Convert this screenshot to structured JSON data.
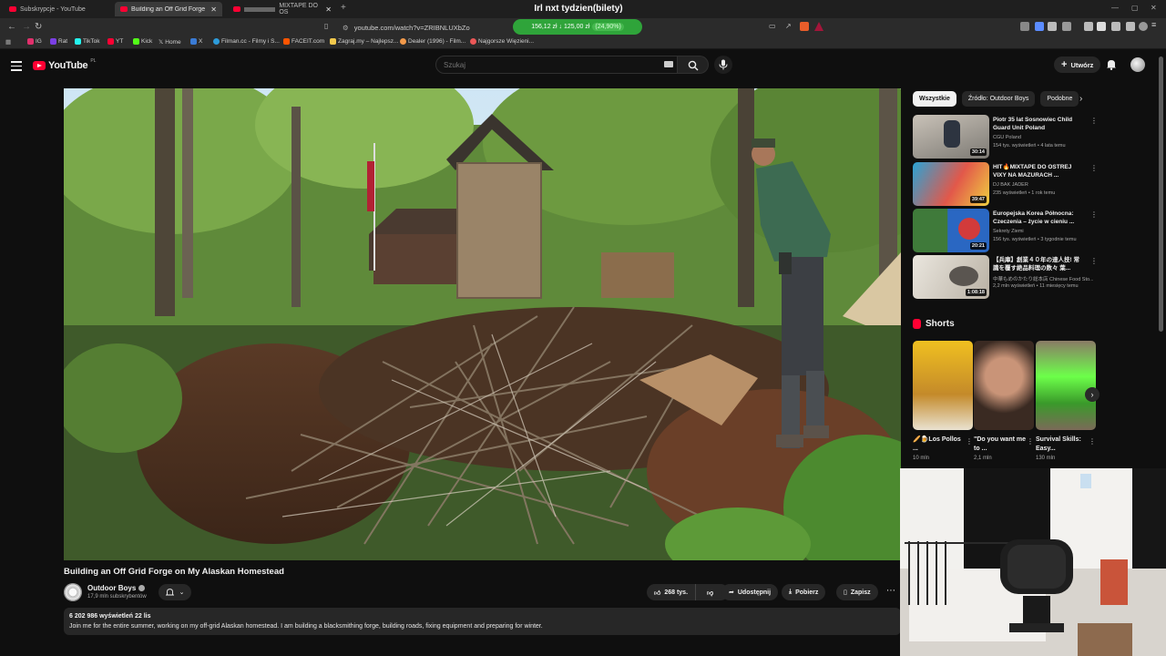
{
  "browser": {
    "tabs": [
      {
        "label": "Subskrypcje - YouTube"
      },
      {
        "label": "Building an Off Grid Forge o"
      },
      {
        "label": "MIXTAPE DO OS"
      }
    ],
    "overlay_title": "Irl nxt tydzien(bilety)",
    "url": "youtube.com/watch?v=ZRIBNLUXbZo",
    "price_widget": {
      "text": "156,12 zł ↓ 125,00 zł",
      "percent": "(24,90%)"
    },
    "bookmarks": [
      {
        "label": "IG",
        "color": "#e1306c"
      },
      {
        "label": "Rat",
        "color": "#7b3fe4"
      },
      {
        "label": "TikTok",
        "color": "#25f4ee"
      },
      {
        "label": "YT",
        "color": "#ff0033"
      },
      {
        "label": "Kick",
        "color": "#53fc18"
      },
      {
        "label": "Home",
        "color": "#ffffff"
      },
      {
        "label": "X",
        "color": "#3a7bd5"
      },
      {
        "label": "Filman.cc - Filmy i S...",
        "color": "#2d9cdb"
      },
      {
        "label": "FACEIT.com",
        "color": "#ff5500"
      },
      {
        "label": "Zagraj.my – Najlepsz...",
        "color": "#f2c94c"
      },
      {
        "label": "Dealer (1996) - Film...",
        "color": "#f2994a"
      },
      {
        "label": "Najgorsze Więzieni...",
        "color": "#eb5757"
      }
    ]
  },
  "header": {
    "logo_text": "YouTube",
    "logo_region": "PL",
    "search_placeholder": "Szukaj",
    "create_label": "Utwórz"
  },
  "video": {
    "title": "Building an Off Grid Forge on My Alaskan Homestead",
    "channel": "Outdoor Boys",
    "subscribers": "17,9 mln subskrybentów",
    "likes": "268 tys.",
    "share_label": "Udostępnij",
    "download_label": "Pobierz",
    "save_label": "Zapisz",
    "stats": "6 202 986 wyświetleń  22 lis",
    "description": "Join me for the entire summer, working on my off-grid Alaskan homestead. I am building a blacksmithing forge, building roads, fixing equipment and preparing for winter."
  },
  "sidebar": {
    "chips": [
      "Wszystkie",
      "Źródło: Outdoor Boys",
      "Podobne"
    ],
    "recommendations": [
      {
        "title": "Piotr 35 lat Sosnowiec Child Guard Unit Poland",
        "channel": "CGU Poland",
        "meta": "154 tys. wyświetleń • 4 lata temu",
        "duration": "30:14"
      },
      {
        "title": "HIT🔥MIXTAPE DO OSTREJ VIXY NA MAZURACH ...",
        "channel": "DJ BAK JADER",
        "meta": "235 wyświetleń • 1 rok temu",
        "duration": "39:47"
      },
      {
        "title": "Europejska Korea Północna: Czeczenia – życie w cieniu ...",
        "channel": "Sekrety Ziemi",
        "meta": "156 tys. wyświetleń • 3 tygodnie temu",
        "duration": "20:21"
      },
      {
        "title": "【兵庫】創業４０年の達人技! 常識を覆す絶品料理の数々 葉...",
        "channel": "中華もめのかたり総本店 Chinese Food Sto...",
        "meta": "2,2 mln wyświetleń • 11 miesięcy temu",
        "duration": "1:08:18"
      }
    ],
    "shorts_heading": "Shorts",
    "shorts": [
      {
        "title": "🥖🍺Los Pollos ...",
        "views": "10 mln"
      },
      {
        "title": "\"Do you want me to ...",
        "views": "2,1 mln"
      },
      {
        "title": "Survival Skills: Easy...",
        "views": "130 mln"
      }
    ]
  }
}
